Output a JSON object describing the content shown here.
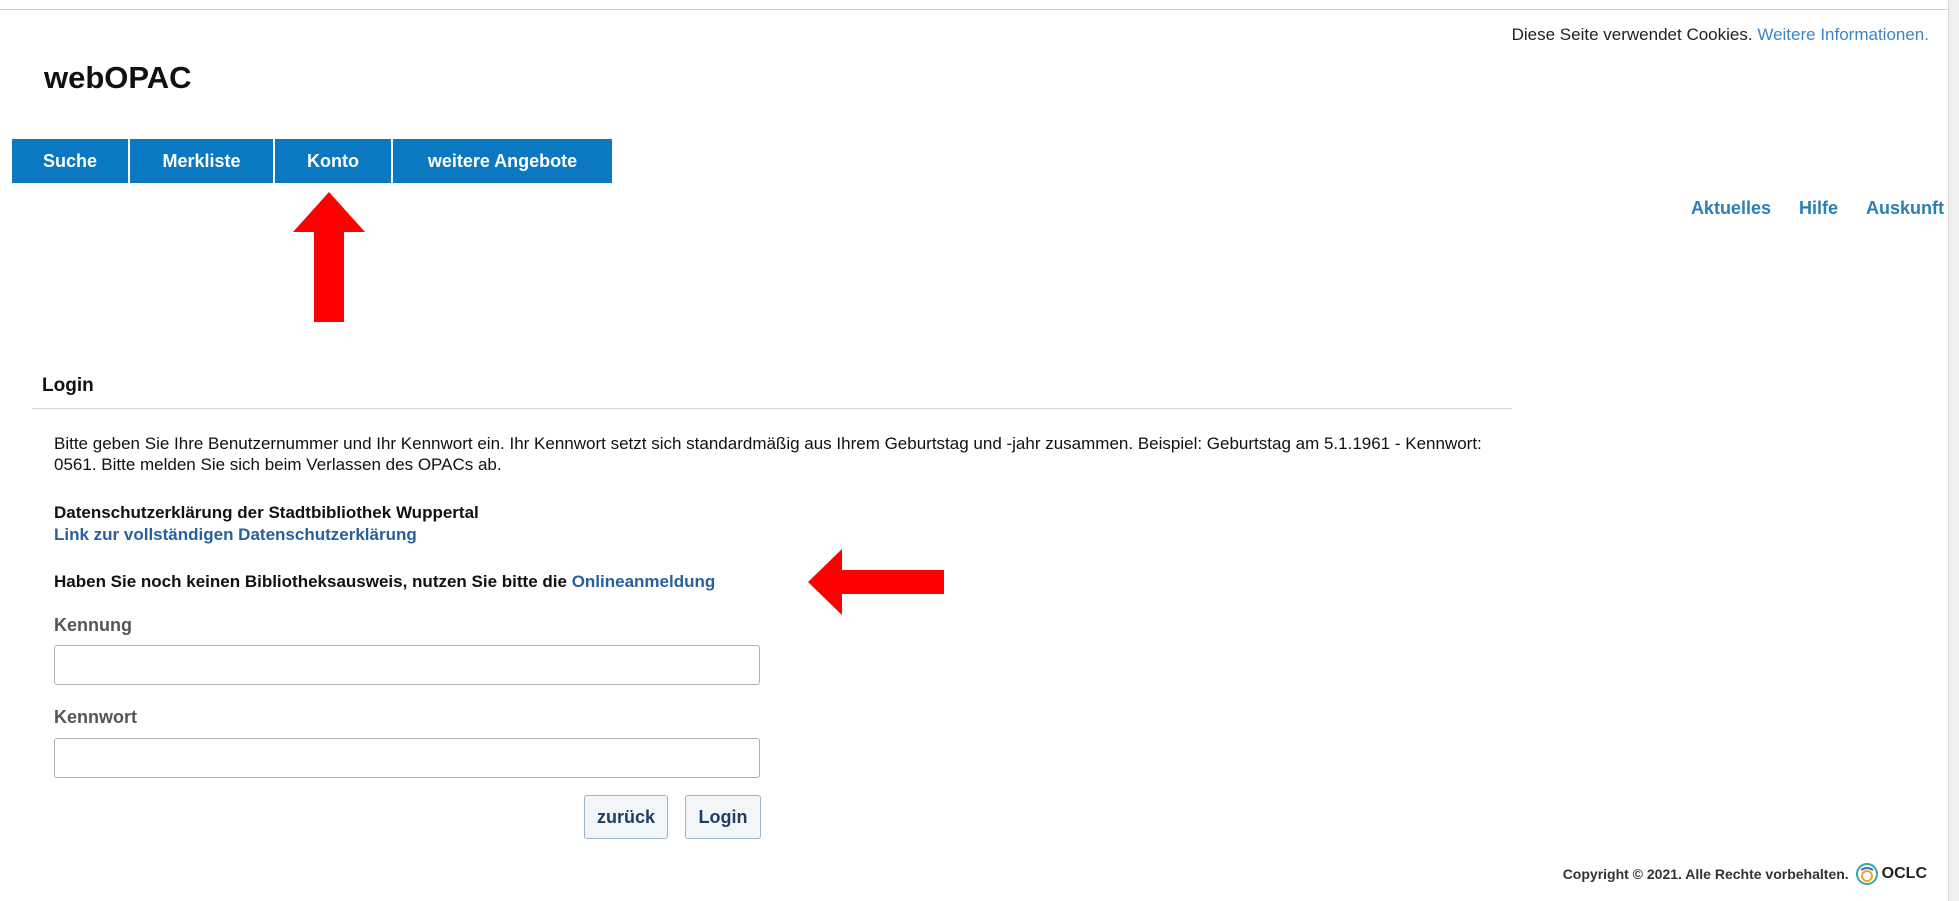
{
  "cookie_notice": {
    "text": "Diese Seite verwendet Cookies.",
    "link": "Weitere Informationen."
  },
  "app_title": "webOPAC",
  "nav": {
    "items": [
      "Suche",
      "Merkliste",
      "Konto",
      "weitere Angebote"
    ]
  },
  "toplinks": [
    "Aktuelles",
    "Hilfe",
    "Auskunft"
  ],
  "login": {
    "title": "Login",
    "intro": "Bitte geben Sie Ihre Benutzernummer und Ihr Kennwort ein. Ihr Kennwort setzt sich standardmäßig aus Ihrem Geburtstag und -jahr zusammen. Beispiel: Geburtstag am 5.1.1961 - Kennwort: 0561. Bitte melden Sie sich beim Verlassen des OPACs ab.",
    "privacy_title": "Datenschutzerklärung der Stadtbibliothek Wuppertal",
    "privacy_link": "Link zur vollständigen Datenschutzerklärung",
    "no_card_text": "Haben Sie noch keinen Bibliotheksausweis, nutzen Sie bitte die",
    "no_card_link": "Onlineanmeldung",
    "label_id": "Kennung",
    "label_password": "Kennwort",
    "id_value": "",
    "password_value": "",
    "back_button": "zurück",
    "login_button": "Login"
  },
  "footer": {
    "copyright": "Copyright © 2021. Alle Rechte vorbehalten.",
    "brand": "OCLC"
  },
  "colors": {
    "nav_bg": "#0b78c2",
    "link": "#2a7fb8",
    "annotation_arrow": "#ff0000"
  },
  "icons": {
    "annotation_up": "red-arrow-up-icon",
    "annotation_left": "red-arrow-left-icon",
    "brand": "oclc-logo-icon"
  }
}
